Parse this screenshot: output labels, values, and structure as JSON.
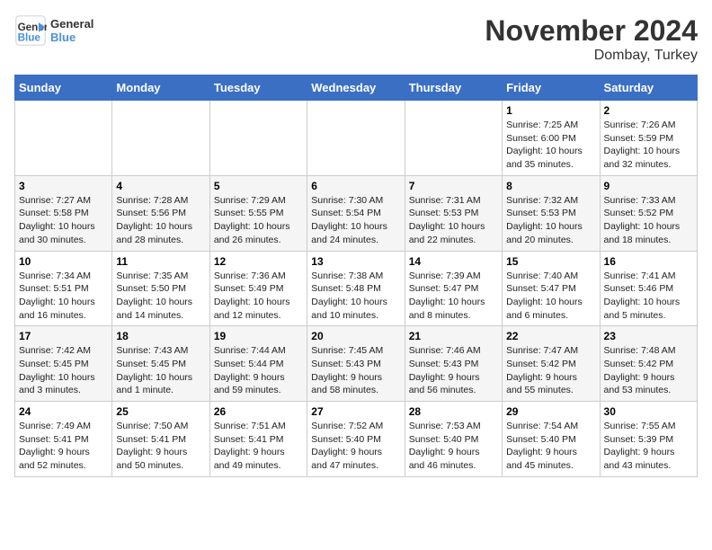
{
  "logo": {
    "line1": "General",
    "line2": "Blue"
  },
  "title": "November 2024",
  "location": "Dombay, Turkey",
  "days_header": [
    "Sunday",
    "Monday",
    "Tuesday",
    "Wednesday",
    "Thursday",
    "Friday",
    "Saturday"
  ],
  "weeks": [
    [
      {
        "day": "",
        "info": ""
      },
      {
        "day": "",
        "info": ""
      },
      {
        "day": "",
        "info": ""
      },
      {
        "day": "",
        "info": ""
      },
      {
        "day": "",
        "info": ""
      },
      {
        "day": "1",
        "info": "Sunrise: 7:25 AM\nSunset: 6:00 PM\nDaylight: 10 hours\nand 35 minutes."
      },
      {
        "day": "2",
        "info": "Sunrise: 7:26 AM\nSunset: 5:59 PM\nDaylight: 10 hours\nand 32 minutes."
      }
    ],
    [
      {
        "day": "3",
        "info": "Sunrise: 7:27 AM\nSunset: 5:58 PM\nDaylight: 10 hours\nand 30 minutes."
      },
      {
        "day": "4",
        "info": "Sunrise: 7:28 AM\nSunset: 5:56 PM\nDaylight: 10 hours\nand 28 minutes."
      },
      {
        "day": "5",
        "info": "Sunrise: 7:29 AM\nSunset: 5:55 PM\nDaylight: 10 hours\nand 26 minutes."
      },
      {
        "day": "6",
        "info": "Sunrise: 7:30 AM\nSunset: 5:54 PM\nDaylight: 10 hours\nand 24 minutes."
      },
      {
        "day": "7",
        "info": "Sunrise: 7:31 AM\nSunset: 5:53 PM\nDaylight: 10 hours\nand 22 minutes."
      },
      {
        "day": "8",
        "info": "Sunrise: 7:32 AM\nSunset: 5:53 PM\nDaylight: 10 hours\nand 20 minutes."
      },
      {
        "day": "9",
        "info": "Sunrise: 7:33 AM\nSunset: 5:52 PM\nDaylight: 10 hours\nand 18 minutes."
      }
    ],
    [
      {
        "day": "10",
        "info": "Sunrise: 7:34 AM\nSunset: 5:51 PM\nDaylight: 10 hours\nand 16 minutes."
      },
      {
        "day": "11",
        "info": "Sunrise: 7:35 AM\nSunset: 5:50 PM\nDaylight: 10 hours\nand 14 minutes."
      },
      {
        "day": "12",
        "info": "Sunrise: 7:36 AM\nSunset: 5:49 PM\nDaylight: 10 hours\nand 12 minutes."
      },
      {
        "day": "13",
        "info": "Sunrise: 7:38 AM\nSunset: 5:48 PM\nDaylight: 10 hours\nand 10 minutes."
      },
      {
        "day": "14",
        "info": "Sunrise: 7:39 AM\nSunset: 5:47 PM\nDaylight: 10 hours\nand 8 minutes."
      },
      {
        "day": "15",
        "info": "Sunrise: 7:40 AM\nSunset: 5:47 PM\nDaylight: 10 hours\nand 6 minutes."
      },
      {
        "day": "16",
        "info": "Sunrise: 7:41 AM\nSunset: 5:46 PM\nDaylight: 10 hours\nand 5 minutes."
      }
    ],
    [
      {
        "day": "17",
        "info": "Sunrise: 7:42 AM\nSunset: 5:45 PM\nDaylight: 10 hours\nand 3 minutes."
      },
      {
        "day": "18",
        "info": "Sunrise: 7:43 AM\nSunset: 5:45 PM\nDaylight: 10 hours\nand 1 minute."
      },
      {
        "day": "19",
        "info": "Sunrise: 7:44 AM\nSunset: 5:44 PM\nDaylight: 9 hours\nand 59 minutes."
      },
      {
        "day": "20",
        "info": "Sunrise: 7:45 AM\nSunset: 5:43 PM\nDaylight: 9 hours\nand 58 minutes."
      },
      {
        "day": "21",
        "info": "Sunrise: 7:46 AM\nSunset: 5:43 PM\nDaylight: 9 hours\nand 56 minutes."
      },
      {
        "day": "22",
        "info": "Sunrise: 7:47 AM\nSunset: 5:42 PM\nDaylight: 9 hours\nand 55 minutes."
      },
      {
        "day": "23",
        "info": "Sunrise: 7:48 AM\nSunset: 5:42 PM\nDaylight: 9 hours\nand 53 minutes."
      }
    ],
    [
      {
        "day": "24",
        "info": "Sunrise: 7:49 AM\nSunset: 5:41 PM\nDaylight: 9 hours\nand 52 minutes."
      },
      {
        "day": "25",
        "info": "Sunrise: 7:50 AM\nSunset: 5:41 PM\nDaylight: 9 hours\nand 50 minutes."
      },
      {
        "day": "26",
        "info": "Sunrise: 7:51 AM\nSunset: 5:41 PM\nDaylight: 9 hours\nand 49 minutes."
      },
      {
        "day": "27",
        "info": "Sunrise: 7:52 AM\nSunset: 5:40 PM\nDaylight: 9 hours\nand 47 minutes."
      },
      {
        "day": "28",
        "info": "Sunrise: 7:53 AM\nSunset: 5:40 PM\nDaylight: 9 hours\nand 46 minutes."
      },
      {
        "day": "29",
        "info": "Sunrise: 7:54 AM\nSunset: 5:40 PM\nDaylight: 9 hours\nand 45 minutes."
      },
      {
        "day": "30",
        "info": "Sunrise: 7:55 AM\nSunset: 5:39 PM\nDaylight: 9 hours\nand 43 minutes."
      }
    ]
  ]
}
